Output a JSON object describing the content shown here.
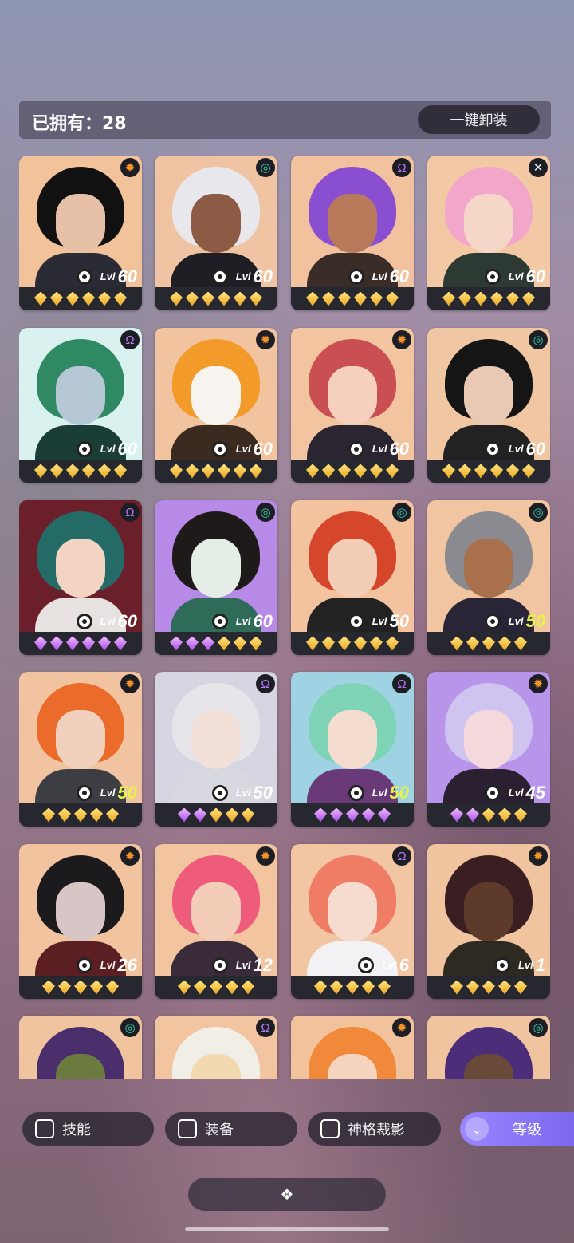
{
  "header": {
    "owned": "已拥有：28",
    "unequip_all": "一键卸装"
  },
  "cards": [
    {
      "elem": "sun",
      "level": "60",
      "lvl_yellow": false,
      "gems": [
        "g",
        "g",
        "g",
        "g",
        "g",
        "g"
      ],
      "bg": "#f2c39a",
      "hair": "#111",
      "face": "#e6c1a8",
      "body": "#2b2b35"
    },
    {
      "elem": "swirl",
      "level": "60",
      "lvl_yellow": false,
      "gems": [
        "g",
        "g",
        "g",
        "g",
        "g",
        "g"
      ],
      "bg": "#f0c4a2",
      "hair": "#e8e8ec",
      "face": "#8c5a45",
      "body": "#1e1e24"
    },
    {
      "elem": "omega",
      "level": "60",
      "lvl_yellow": false,
      "gems": [
        "g",
        "g",
        "g",
        "g",
        "g",
        "g"
      ],
      "bg": "#f1c29d",
      "hair": "#8a4fd1",
      "face": "#b87a5a",
      "body": "#3a2c26"
    },
    {
      "elem": "cross",
      "level": "60",
      "lvl_yellow": false,
      "gems": [
        "g",
        "g",
        "g",
        "g",
        "g",
        "g"
      ],
      "bg": "#f3c8a5",
      "hair": "#f2a6c9",
      "face": "#f5d7c8",
      "body": "#2d3a34"
    },
    {
      "elem": "omega",
      "level": "60",
      "lvl_yellow": false,
      "gems": [
        "g",
        "g",
        "g",
        "g",
        "g",
        "g"
      ],
      "bg": "#d9f1ef",
      "hair": "#2f8a64",
      "face": "#b6c7d6",
      "body": "#1a3d35"
    },
    {
      "elem": "sun",
      "level": "60",
      "lvl_yellow": false,
      "gems": [
        "g",
        "g",
        "g",
        "g",
        "g",
        "g"
      ],
      "bg": "#f1c39e",
      "hair": "#f29a2a",
      "face": "#f7f3ee",
      "body": "#3a2a1f"
    },
    {
      "elem": "sun",
      "level": "60",
      "lvl_yellow": false,
      "gems": [
        "g",
        "g",
        "g",
        "g",
        "g",
        "g"
      ],
      "bg": "#f2c4a0",
      "hair": "#c94f52",
      "face": "#f5d0be",
      "body": "#2a2530"
    },
    {
      "elem": "swirl",
      "level": "60",
      "lvl_yellow": false,
      "gems": [
        "g",
        "g",
        "g",
        "g",
        "g",
        "g"
      ],
      "bg": "#f0c6a3",
      "hair": "#151515",
      "face": "#e9c9b3",
      "body": "#222"
    },
    {
      "elem": "omega",
      "level": "60",
      "lvl_yellow": false,
      "gems": [
        "p",
        "p",
        "p",
        "p",
        "p",
        "p"
      ],
      "bg": "#6b1f2a",
      "hair": "#246a66",
      "face": "#f3d4c2",
      "body": "#e7e2e0"
    },
    {
      "elem": "swirl",
      "level": "60",
      "lvl_yellow": false,
      "gems": [
        "p",
        "p",
        "p",
        "g",
        "g",
        "g"
      ],
      "bg": "#b68ae6",
      "hair": "#1e1a1a",
      "face": "#e4ede6",
      "body": "#2e6b58"
    },
    {
      "elem": "swirl",
      "level": "50",
      "lvl_yellow": false,
      "gems": [
        "g",
        "g",
        "g",
        "g",
        "g",
        "g"
      ],
      "bg": "#f2c39e",
      "hair": "#d6462a",
      "face": "#f3cdb6",
      "body": "#222"
    },
    {
      "elem": "swirl",
      "level": "50",
      "lvl_yellow": true,
      "gems": [
        "g",
        "g",
        "g",
        "g",
        "g"
      ],
      "bg": "#f1c5a2",
      "hair": "#8a8a90",
      "face": "#a9704e",
      "body": "#2a2536"
    },
    {
      "elem": "sun",
      "level": "50",
      "lvl_yellow": true,
      "gems": [
        "g",
        "g",
        "g",
        "g",
        "g"
      ],
      "bg": "#f2c3a0",
      "hair": "#ea6b2a",
      "face": "#f1d0be",
      "body": "#3d3d44"
    },
    {
      "elem": "omega",
      "level": "50",
      "lvl_yellow": false,
      "gems": [
        "p",
        "p",
        "g",
        "g",
        "g"
      ],
      "bg": "#d5d6e2",
      "hair": "#e6e6ea",
      "face": "#f1dfd8",
      "body": "#d8d8e0"
    },
    {
      "elem": "omega",
      "level": "50",
      "lvl_yellow": true,
      "gems": [
        "p",
        "p",
        "p",
        "p",
        "p"
      ],
      "bg": "#9fd3e4",
      "hair": "#7fd3b6",
      "face": "#f4dccf",
      "body": "#6a3a78"
    },
    {
      "elem": "sun",
      "level": "45",
      "lvl_yellow": false,
      "gems": [
        "p",
        "p",
        "g",
        "g",
        "g"
      ],
      "bg": "#b895ea",
      "hair": "#cfc4ef",
      "face": "#f4d8dc",
      "body": "#2a2030"
    },
    {
      "elem": "sun",
      "level": "26",
      "lvl_yellow": false,
      "gems": [
        "g",
        "g",
        "g",
        "g",
        "g"
      ],
      "bg": "#f1c39f",
      "hair": "#1b1b1e",
      "face": "#d8c6c6",
      "body": "#5b1f23"
    },
    {
      "elem": "sun",
      "level": "12",
      "lvl_yellow": false,
      "gems": [
        "g",
        "g",
        "g",
        "g",
        "g"
      ],
      "bg": "#f2c49f",
      "hair": "#ef5b7a",
      "face": "#f4cdb9",
      "body": "#3a2b3a"
    },
    {
      "elem": "omega",
      "level": "6",
      "lvl_yellow": false,
      "gems": [
        "g",
        "g",
        "g",
        "g",
        "g"
      ],
      "bg": "#f2c6a2",
      "hair": "#ef7d66",
      "face": "#f6dccf",
      "body": "#f2f2f4"
    },
    {
      "elem": "sun",
      "level": "1",
      "lvl_yellow": false,
      "gems": [
        "g",
        "g",
        "g",
        "g",
        "g"
      ],
      "bg": "#f1c4a0",
      "hair": "#3a1f22",
      "face": "#5e3a2a",
      "body": "#2d2a22"
    },
    {
      "elem": "swirl",
      "level": "",
      "lvl_yellow": false,
      "gems": [],
      "bg": "#f1c4a0",
      "hair": "#4a2f6c",
      "face": "#6b7a3f",
      "body": "#2a2530"
    },
    {
      "elem": "omega",
      "level": "",
      "lvl_yellow": false,
      "gems": [],
      "bg": "#f2c4a0",
      "hair": "#f1eee6",
      "face": "#f3d9b0",
      "body": "#ddd"
    },
    {
      "elem": "sun",
      "level": "",
      "lvl_yellow": false,
      "gems": [],
      "bg": "#f2c29c",
      "hair": "#f08a3a",
      "face": "#f5d5c0",
      "body": "#ddd"
    },
    {
      "elem": "swirl",
      "level": "",
      "lvl_yellow": false,
      "gems": [],
      "bg": "#f1c4a0",
      "hair": "#4b2d7a",
      "face": "#6a4a38",
      "body": "#333"
    }
  ],
  "lvl_tag": "Lvl",
  "elem_icons": {
    "sun": "✹",
    "swirl": "◎",
    "omega": "Ω",
    "cross": "✕"
  },
  "elem_colors": {
    "sun": "#f5932a",
    "swirl": "#3ad0b0",
    "omega": "#b677ff",
    "cross": "#e6f1ff"
  },
  "filters": {
    "skill": "技能",
    "equip": "装备",
    "shadow": "神格裁影",
    "sort": "等级"
  }
}
